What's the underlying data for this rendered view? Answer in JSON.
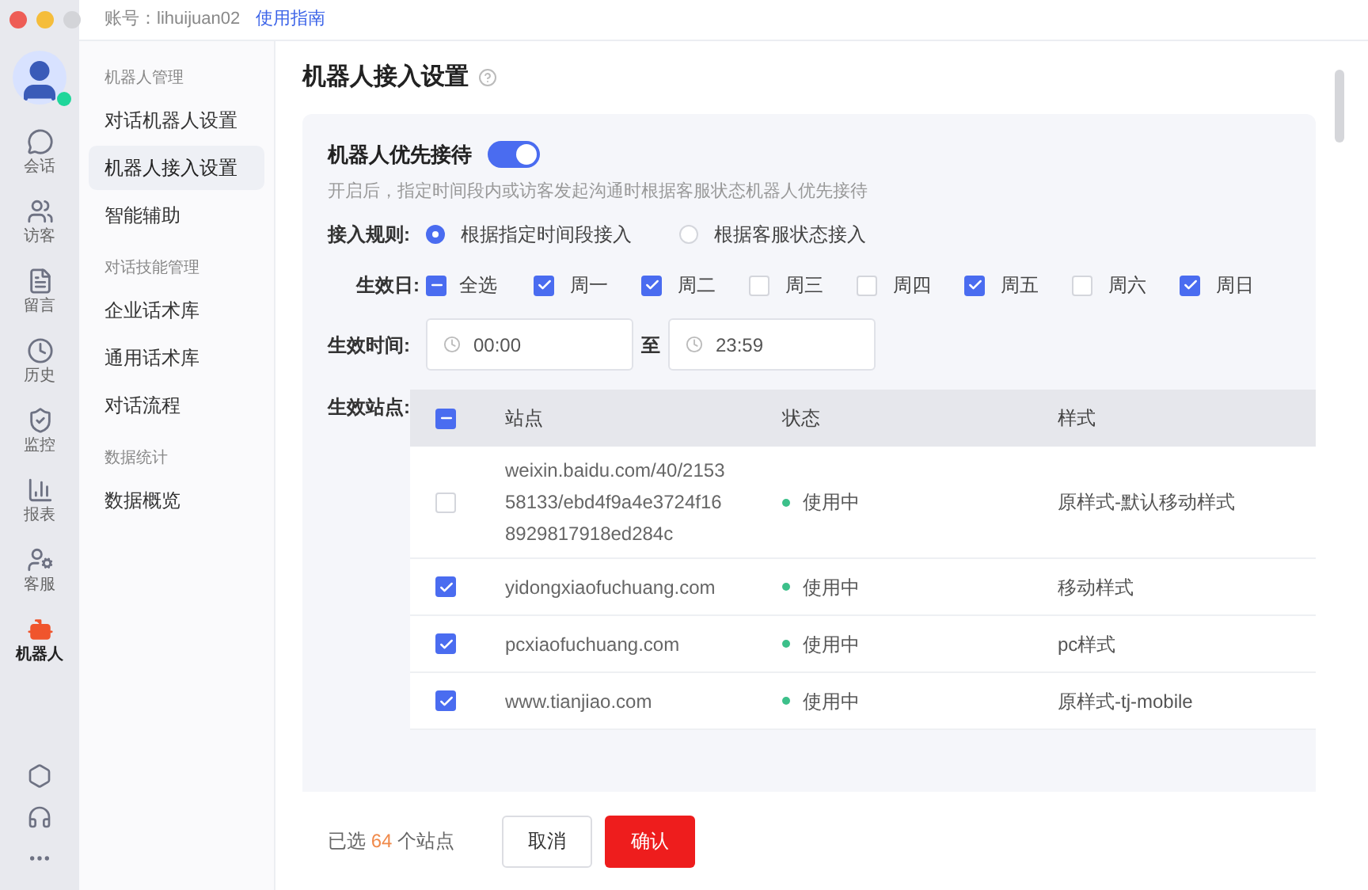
{
  "top_bar": {
    "account_label": "账号：lihuijuan02",
    "guide_link": "使用指南"
  },
  "rail": {
    "items": [
      {
        "kind": "chat",
        "label": "会话",
        "selected": false
      },
      {
        "kind": "visitors",
        "label": "访客",
        "selected": false
      },
      {
        "kind": "message",
        "label": "留言",
        "selected": false
      },
      {
        "kind": "history",
        "label": "历史",
        "selected": false
      },
      {
        "kind": "monitor",
        "label": "监控",
        "selected": false
      },
      {
        "kind": "report",
        "label": "报表",
        "selected": false
      },
      {
        "kind": "agent",
        "label": "客服",
        "selected": false
      },
      {
        "kind": "robot",
        "label": "机器人",
        "selected": true
      }
    ]
  },
  "sidebar": {
    "groups": [
      {
        "title": "机器人管理",
        "items": [
          {
            "label": "对话机器人设置",
            "selected": false
          },
          {
            "label": "机器人接入设置",
            "selected": true
          },
          {
            "label": "智能辅助",
            "selected": false
          }
        ]
      },
      {
        "title": "对话技能管理",
        "items": [
          {
            "label": "企业话术库",
            "selected": false
          },
          {
            "label": "通用话术库",
            "selected": false
          },
          {
            "label": "对话流程",
            "selected": false
          }
        ]
      },
      {
        "title": "数据统计",
        "items": [
          {
            "label": "数据概览",
            "selected": false
          }
        ]
      }
    ]
  },
  "page": {
    "title": "机器人接入设置",
    "priority": {
      "label": "机器人优先接待",
      "on": true,
      "description": "开启后，指定时间段内或访客发起沟通时根据客服状态机器人优先接待"
    },
    "rule": {
      "label": "接入规则:",
      "options": [
        {
          "label": "根据指定时间段接入",
          "selected": true
        },
        {
          "label": "根据客服状态接入",
          "selected": false
        }
      ]
    },
    "days": {
      "label": "生效日:",
      "select_all": {
        "label": "全选",
        "indeterminate": true
      },
      "items": [
        {
          "label": "周一",
          "checked": true
        },
        {
          "label": "周二",
          "checked": true
        },
        {
          "label": "周三",
          "checked": false
        },
        {
          "label": "周四",
          "checked": false
        },
        {
          "label": "周五",
          "checked": true
        },
        {
          "label": "周六",
          "checked": false
        },
        {
          "label": "周日",
          "checked": true
        }
      ]
    },
    "time": {
      "label": "生效时间:",
      "start": "00:00",
      "separator": "至",
      "end": "23:59"
    },
    "sites": {
      "label": "生效站点:",
      "header_checkbox": {
        "indeterminate": true
      },
      "columns": [
        "站点",
        "状态",
        "样式"
      ],
      "rows": [
        {
          "checked": false,
          "site": "weixin.baidu.com/40/215358133/ebd4f9a4e3724f168929817918ed284c",
          "status": "使用中",
          "style": "原样式-默认移动样式"
        },
        {
          "checked": true,
          "site": "yidongxiaofuchuang.com",
          "status": "使用中",
          "style": "移动样式"
        },
        {
          "checked": true,
          "site": "pcxiaofuchuang.com",
          "status": "使用中",
          "style": "pc样式"
        },
        {
          "checked": true,
          "site": "www.tianjiao.com",
          "status": "使用中",
          "style": "原样式-tj-mobile"
        }
      ]
    }
  },
  "footer": {
    "prefix": "已选",
    "count": "64",
    "suffix": "个站点",
    "cancel": "取消",
    "confirm": "确认"
  }
}
